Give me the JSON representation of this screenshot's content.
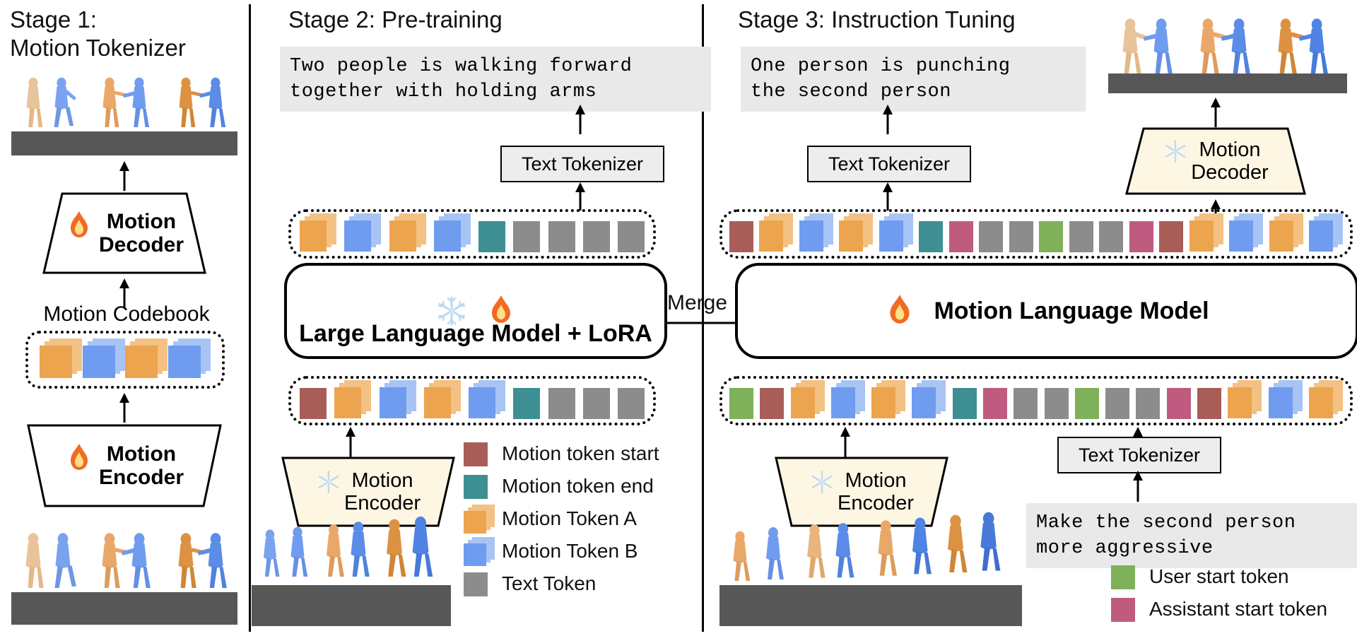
{
  "stages": {
    "stage1": {
      "title": "Stage 1:\nMotion Tokenizer",
      "codebook_label": "Motion Codebook",
      "decoder_label": "Motion\nDecoder",
      "decoder_icon": "fire-icon",
      "encoder_label": "Motion\nEncoder",
      "encoder_icon": "fire-icon",
      "codebook_tokens": [
        "A",
        "B",
        "A",
        "B"
      ]
    },
    "stage2": {
      "title": "Stage 2: Pre-training",
      "output_text": "Two people is walking forward\ntogether with holding arms",
      "text_tokenizer_label": "Text Tokenizer",
      "model_label": "Large Language Model + LoRA",
      "model_icons": [
        "snowflake-icon",
        "fire-icon"
      ],
      "encoder_label": "Motion\nEncoder",
      "encoder_icon": "snowflake-icon",
      "output_tokens": [
        "A",
        "B",
        "A",
        "B",
        "end",
        "text",
        "text",
        "text",
        "text"
      ],
      "input_tokens": [
        "start",
        "A",
        "B",
        "A",
        "B",
        "end",
        "text",
        "text",
        "text"
      ]
    },
    "stage3": {
      "title": "Stage 3: Instruction Tuning",
      "output_text": "One person is punching\nthe second person",
      "text_tokenizer_top_label": "Text Tokenizer",
      "text_tokenizer_bottom_label": "Text Tokenizer",
      "model_label": "Motion Language Model",
      "model_icon": "fire-icon",
      "decoder_label": "Motion\nDecoder",
      "decoder_icon": "snowflake-icon",
      "encoder_label": "Motion\nEncoder",
      "encoder_icon": "snowflake-icon",
      "instruction_text": "Make the second person\nmore aggressive",
      "output_tokens": [
        "start",
        "A",
        "B",
        "A",
        "B",
        "end",
        "assistant",
        "text",
        "text",
        "user",
        "text",
        "text",
        "assistant",
        "start",
        "A",
        "B",
        "A",
        "B"
      ],
      "input_tokens": [
        "user",
        "start",
        "A",
        "B",
        "A",
        "B",
        "end",
        "assistant",
        "text",
        "text",
        "user",
        "text",
        "text",
        "assistant",
        "start",
        "A",
        "B",
        "A"
      ]
    }
  },
  "merge_label": "Merge",
  "legend_main": [
    {
      "key": "start",
      "label": "Motion token start"
    },
    {
      "key": "end",
      "label": "Motion token end"
    },
    {
      "key": "A",
      "label": "Motion Token A"
    },
    {
      "key": "B",
      "label": "Motion Token B"
    },
    {
      "key": "text",
      "label": "Text Token"
    }
  ],
  "legend_chat": [
    {
      "key": "user",
      "label": "User start token"
    },
    {
      "key": "assistant",
      "label": "Assistant start token"
    }
  ],
  "colors": {
    "start": "#a95d57",
    "end": "#3d8f94",
    "A": "#eda44e",
    "A2": "#f3c183",
    "B": "#6f9cef",
    "B2": "#a8c4f5",
    "text": "#8c8c8c",
    "user": "#7fb05a",
    "assistant": "#bf5b7e",
    "ground": "#575757",
    "module_fill": "#fdf6e3",
    "box_fill": "#ededed"
  }
}
